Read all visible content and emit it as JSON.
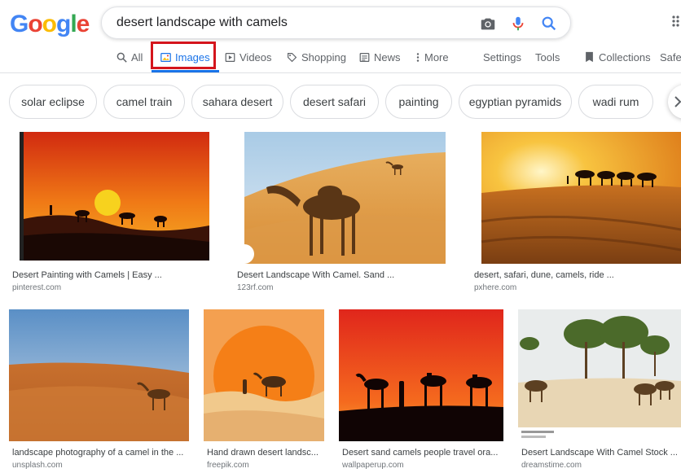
{
  "logo": {
    "letters": [
      "G",
      "o",
      "o",
      "g",
      "l",
      "e"
    ],
    "colors": [
      "#4285f4",
      "#ea4335",
      "#fbbc05",
      "#4285f4",
      "#34a853",
      "#ea4335"
    ]
  },
  "search": {
    "query": "desert landscape with camels"
  },
  "tabs": [
    {
      "label": "All"
    },
    {
      "label": "Images"
    },
    {
      "label": "Videos"
    },
    {
      "label": "Shopping"
    },
    {
      "label": "News"
    },
    {
      "label": "More"
    },
    {
      "label": "Settings"
    },
    {
      "label": "Tools"
    }
  ],
  "collections": {
    "label": "Collections",
    "safesearch": "SafeS"
  },
  "chips": [
    "solar eclipse",
    "camel train",
    "sahara desert",
    "desert safari",
    "painting",
    "egyptian pyramids",
    "wadi rum"
  ],
  "results": [
    {
      "title": "Desert Painting with Camels | Easy ...",
      "source": "pinterest.com"
    },
    {
      "title": "Desert Landscape With Camel. Sand ...",
      "source": "123rf.com"
    },
    {
      "title": "desert, safari, dune, camels, ride ...",
      "source": "pxhere.com"
    },
    {
      "title": "landscape photography of a camel in the ...",
      "source": "unsplash.com"
    },
    {
      "title": "Hand drawn desert landsc...",
      "source": "freepik.com"
    },
    {
      "title": "Desert sand camels people travel ora...",
      "source": "wallpaperup.com"
    },
    {
      "title": "Desert Landscape With Camel Stock ...",
      "source": "dreamstime.com"
    }
  ],
  "colors": {
    "accent": "#1a73e8",
    "highlight": "#d4151c"
  }
}
